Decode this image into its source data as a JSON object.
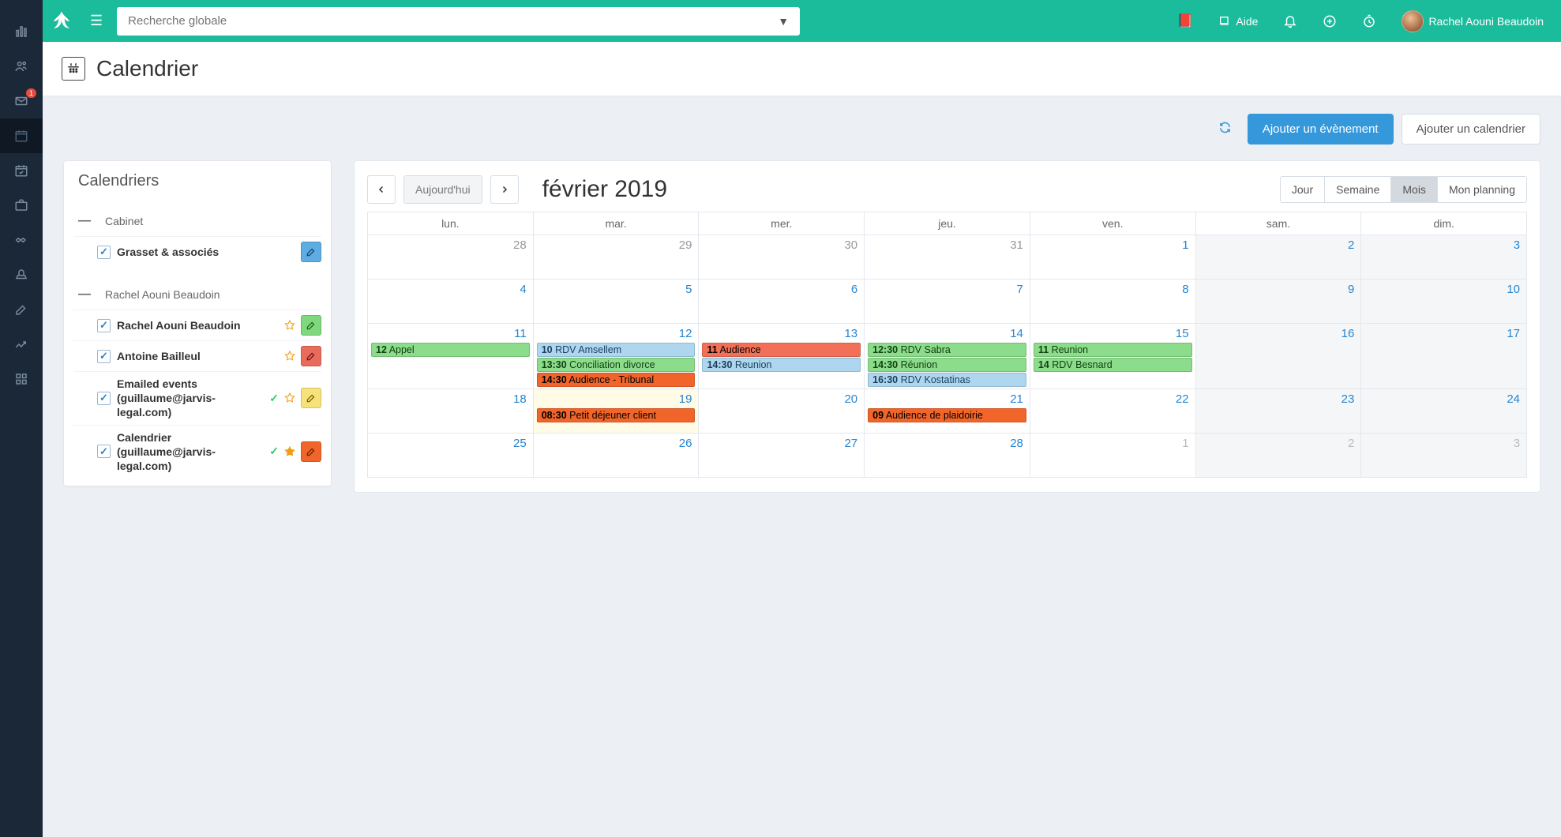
{
  "topbar": {
    "search_placeholder": "Recherche globale",
    "help_label": "Aide",
    "user_name": "Rachel Aouni Beaudoin"
  },
  "nav": {
    "mail_badge": "1"
  },
  "page": {
    "title": "Calendrier"
  },
  "actions": {
    "add_event": "Ajouter un évènement",
    "add_calendar": "Ajouter un calendrier"
  },
  "left": {
    "panel_title": "Calendriers",
    "groups": [
      {
        "name": "Cabinet",
        "items": [
          {
            "label": "Grasset & associés",
            "checked": true,
            "shared": false,
            "star": "none",
            "edit_color": "edit-blue"
          }
        ]
      },
      {
        "name": "Rachel Aouni Beaudoin",
        "items": [
          {
            "label": "Rachel Aouni Beaudoin",
            "checked": true,
            "shared": false,
            "star": "outline",
            "edit_color": "edit-green"
          },
          {
            "label": "Antoine Bailleul",
            "checked": true,
            "shared": false,
            "star": "outline",
            "edit_color": "edit-red"
          },
          {
            "label": "Emailed events (guillaume@jarvis-legal.com)",
            "checked": true,
            "shared": true,
            "star": "outline",
            "edit_color": "edit-yellow"
          },
          {
            "label": "Calendrier (guillaume@jarvis-legal.com)",
            "checked": true,
            "shared": true,
            "star": "filled",
            "edit_color": "edit-orange"
          }
        ]
      }
    ]
  },
  "calendar": {
    "title": "février 2019",
    "today_label": "Aujourd'hui",
    "views": {
      "day": "Jour",
      "week": "Semaine",
      "month": "Mois",
      "planning": "Mon planning",
      "active": "month"
    },
    "day_headers": [
      "lun.",
      "mar.",
      "mer.",
      "jeu.",
      "ven.",
      "sam.",
      "dim."
    ],
    "weeks": [
      [
        {
          "num": "28",
          "other": true,
          "weekend": false
        },
        {
          "num": "29",
          "other": true,
          "weekend": false
        },
        {
          "num": "30",
          "other": true,
          "weekend": false
        },
        {
          "num": "31",
          "other": true,
          "weekend": false
        },
        {
          "num": "1",
          "weekend": false
        },
        {
          "num": "2",
          "weekend": true
        },
        {
          "num": "3",
          "weekend": true
        }
      ],
      [
        {
          "num": "4"
        },
        {
          "num": "5"
        },
        {
          "num": "6"
        },
        {
          "num": "7"
        },
        {
          "num": "8"
        },
        {
          "num": "9",
          "weekend": true
        },
        {
          "num": "10",
          "weekend": true
        }
      ],
      [
        {
          "num": "11",
          "events": [
            {
              "t": "12",
              "txt": "Appel",
              "c": "ev-green"
            }
          ]
        },
        {
          "num": "12",
          "events": [
            {
              "t": "10",
              "txt": "RDV Amsellem",
              "c": "ev-blue"
            },
            {
              "t": "13:30",
              "txt": "Conciliation divorce",
              "c": "ev-green"
            },
            {
              "t": "14:30",
              "txt": "Audience - Tribunal",
              "c": "ev-orange"
            }
          ]
        },
        {
          "num": "13",
          "events": [
            {
              "t": "11",
              "txt": "Audience",
              "c": "ev-red"
            },
            {
              "t": "14:30",
              "txt": "Reunion",
              "c": "ev-blue"
            }
          ]
        },
        {
          "num": "14",
          "events": [
            {
              "t": "12:30",
              "txt": "RDV Sabra",
              "c": "ev-green"
            },
            {
              "t": "14:30",
              "txt": "Réunion",
              "c": "ev-green"
            },
            {
              "t": "16:30",
              "txt": "RDV Kostatinas",
              "c": "ev-blue"
            }
          ]
        },
        {
          "num": "15",
          "events": [
            {
              "t": "11",
              "txt": "Reunion",
              "c": "ev-green"
            },
            {
              "t": "14",
              "txt": "RDV Besnard",
              "c": "ev-green"
            }
          ]
        },
        {
          "num": "16",
          "weekend": true
        },
        {
          "num": "17",
          "weekend": true
        }
      ],
      [
        {
          "num": "18"
        },
        {
          "num": "19",
          "today": true,
          "events": [
            {
              "t": "08:30",
              "txt": "Petit déjeuner client",
              "c": "ev-orange"
            }
          ]
        },
        {
          "num": "20"
        },
        {
          "num": "21",
          "events": [
            {
              "t": "09",
              "txt": "Audience de plaidoirie",
              "c": "ev-orange"
            }
          ]
        },
        {
          "num": "22"
        },
        {
          "num": "23",
          "weekend": true
        },
        {
          "num": "24",
          "weekend": true
        }
      ],
      [
        {
          "num": "25"
        },
        {
          "num": "26"
        },
        {
          "num": "27"
        },
        {
          "num": "28"
        },
        {
          "num": "1",
          "other": true,
          "muted": true
        },
        {
          "num": "2",
          "other": true,
          "weekend": true,
          "muted": true
        },
        {
          "num": "3",
          "other": true,
          "weekend": true,
          "muted": true
        }
      ]
    ]
  }
}
